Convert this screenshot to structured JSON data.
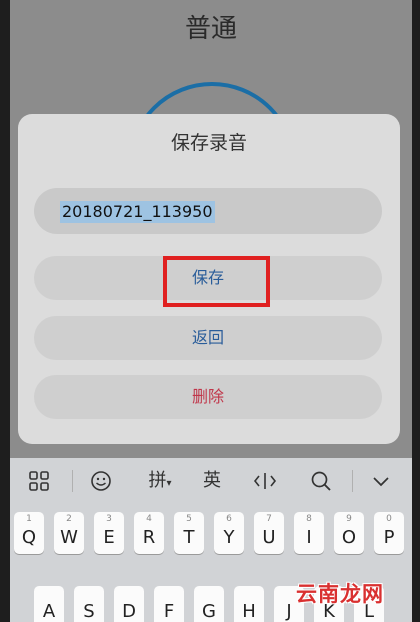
{
  "background": {
    "title": "普通"
  },
  "dialog": {
    "title": "保存录音",
    "filename": "20180721_113950",
    "save_label": "保存",
    "back_label": "返回",
    "delete_label": "删除"
  },
  "keyboard": {
    "toolbar": {
      "pinyin_label": "拼",
      "english_label": "英"
    },
    "row1": [
      {
        "letter": "Q",
        "digit": "1"
      },
      {
        "letter": "W",
        "digit": "2"
      },
      {
        "letter": "E",
        "digit": "3"
      },
      {
        "letter": "R",
        "digit": "4"
      },
      {
        "letter": "T",
        "digit": "5"
      },
      {
        "letter": "Y",
        "digit": "6"
      },
      {
        "letter": "U",
        "digit": "7"
      },
      {
        "letter": "I",
        "digit": "8"
      },
      {
        "letter": "O",
        "digit": "9"
      },
      {
        "letter": "P",
        "digit": "0"
      }
    ],
    "row2": [
      {
        "letter": "A"
      },
      {
        "letter": "S"
      },
      {
        "letter": "D"
      },
      {
        "letter": "F"
      },
      {
        "letter": "G"
      },
      {
        "letter": "H"
      },
      {
        "letter": "J"
      },
      {
        "letter": "K"
      },
      {
        "letter": "L"
      }
    ]
  },
  "watermark": "云南龙网",
  "colors": {
    "highlight_box": "#e02020",
    "primary_text": "#2a5d9a",
    "danger_text": "#c0364a"
  }
}
